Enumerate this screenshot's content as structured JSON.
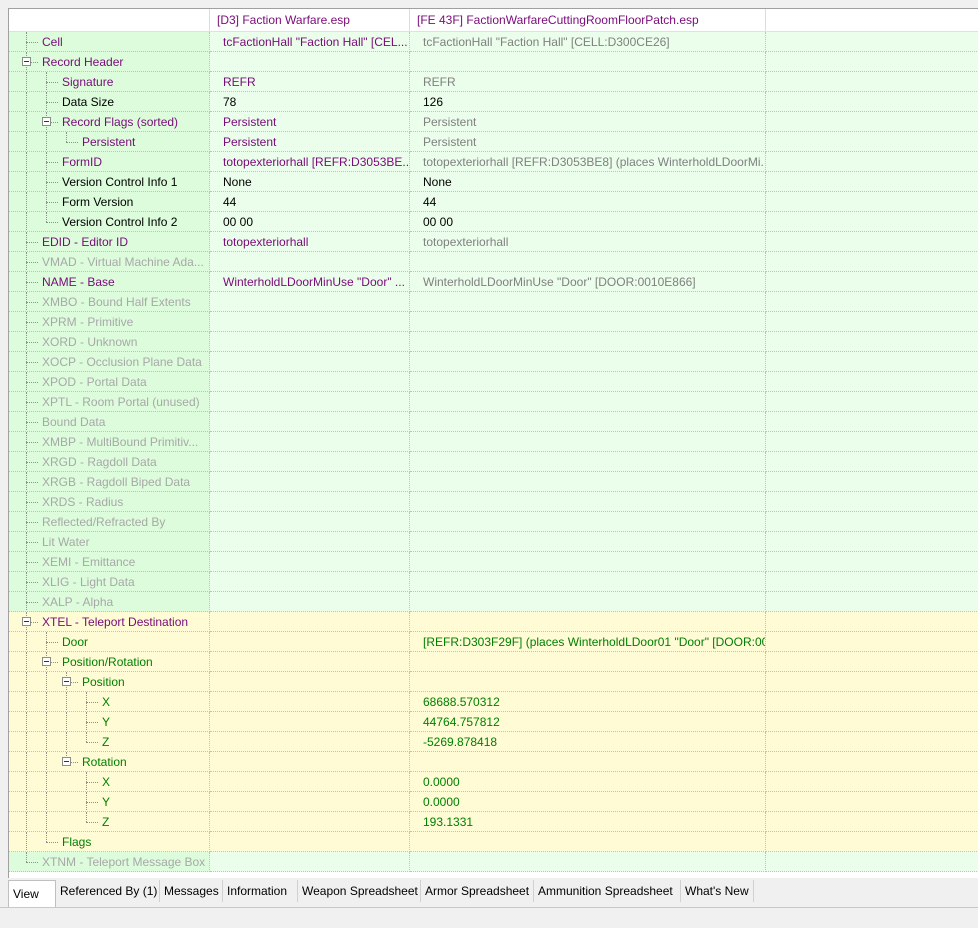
{
  "colors": {
    "win_green": "#dcfcdc",
    "lose_green": "#ebfdeb",
    "add_yellow": "#fffbd5",
    "purple_text": "#7a0b7a",
    "green_text": "#008000",
    "gray_text": "#808080",
    "dim_text": "#a8a8a8"
  },
  "columns": {
    "plugin1": "[D3] Faction Warfare.esp",
    "plugin2": "[FE 43F] FactionWarfareCuttingRoomFloorPatch.esp"
  },
  "rows": [
    {
      "label": "Cell",
      "level": 0,
      "toggle": false,
      "v1": "tcFactionHall \"Faction Hall\" [CEL...",
      "v2": "tcFactionHall \"Faction Hall\" [CELL:D300CE26]",
      "style": "conflict"
    },
    {
      "label": "Record Header",
      "level": 0,
      "toggle": true,
      "v1": "",
      "v2": "",
      "style": "conflict"
    },
    {
      "label": "Signature",
      "level": 1,
      "toggle": false,
      "v1": "REFR",
      "v2": "REFR",
      "style": "conflict"
    },
    {
      "label": "Data Size",
      "level": 1,
      "toggle": false,
      "v1": "78",
      "v2": "126",
      "style": "neutral"
    },
    {
      "label": "Record Flags (sorted)",
      "level": 1,
      "toggle": true,
      "v1": "Persistent",
      "v2": "Persistent",
      "style": "conflict"
    },
    {
      "label": "Persistent",
      "level": 2,
      "toggle": false,
      "v1": "Persistent",
      "v2": "Persistent",
      "style": "conflict"
    },
    {
      "label": "FormID",
      "level": 1,
      "toggle": false,
      "v1": "totopexteriorhall [REFR:D3053BE...",
      "v2": "totopexteriorhall [REFR:D3053BE8] (places WinterholdLDoorMi...",
      "style": "conflict"
    },
    {
      "label": "Version Control Info 1",
      "level": 1,
      "toggle": false,
      "v1": "None",
      "v2": "None",
      "style": "neutral"
    },
    {
      "label": "Form Version",
      "level": 1,
      "toggle": false,
      "v1": "44",
      "v2": "44",
      "style": "neutral"
    },
    {
      "label": "Version Control Info 2",
      "level": 1,
      "toggle": false,
      "v1": "00 00",
      "v2": "00 00",
      "style": "neutral"
    },
    {
      "label": "EDID - Editor ID",
      "level": 0,
      "toggle": false,
      "v1": "totopexteriorhall",
      "v2": "totopexteriorhall",
      "style": "conflict"
    },
    {
      "label": "VMAD - Virtual Machine Ada...",
      "level": 0,
      "toggle": false,
      "v1": "",
      "v2": "",
      "style": "empty"
    },
    {
      "label": "NAME - Base",
      "level": 0,
      "toggle": false,
      "v1": "WinterholdLDoorMinUse \"Door\" ...",
      "v2": "WinterholdLDoorMinUse \"Door\" [DOOR:0010E866]",
      "style": "conflict"
    },
    {
      "label": "XMBO - Bound Half Extents",
      "level": 0,
      "toggle": false,
      "v1": "",
      "v2": "",
      "style": "empty"
    },
    {
      "label": "XPRM - Primitive",
      "level": 0,
      "toggle": false,
      "v1": "",
      "v2": "",
      "style": "empty"
    },
    {
      "label": "XORD - Unknown",
      "level": 0,
      "toggle": false,
      "v1": "",
      "v2": "",
      "style": "empty"
    },
    {
      "label": "XOCP - Occlusion Plane Data",
      "level": 0,
      "toggle": false,
      "v1": "",
      "v2": "",
      "style": "empty"
    },
    {
      "label": "XPOD - Portal Data",
      "level": 0,
      "toggle": false,
      "v1": "",
      "v2": "",
      "style": "empty"
    },
    {
      "label": "XPTL - Room Portal (unused)",
      "level": 0,
      "toggle": false,
      "v1": "",
      "v2": "",
      "style": "empty"
    },
    {
      "label": "Bound Data",
      "level": 0,
      "toggle": false,
      "v1": "",
      "v2": "",
      "style": "empty"
    },
    {
      "label": "XMBP - MultiBound Primitiv...",
      "level": 0,
      "toggle": false,
      "v1": "",
      "v2": "",
      "style": "empty"
    },
    {
      "label": "XRGD - Ragdoll Data",
      "level": 0,
      "toggle": false,
      "v1": "",
      "v2": "",
      "style": "empty"
    },
    {
      "label": "XRGB - Ragdoll Biped Data",
      "level": 0,
      "toggle": false,
      "v1": "",
      "v2": "",
      "style": "empty"
    },
    {
      "label": "XRDS - Radius",
      "level": 0,
      "toggle": false,
      "v1": "",
      "v2": "",
      "style": "empty"
    },
    {
      "label": "Reflected/Refracted By",
      "level": 0,
      "toggle": false,
      "v1": "",
      "v2": "",
      "style": "empty"
    },
    {
      "label": "Lit Water",
      "level": 0,
      "toggle": false,
      "v1": "",
      "v2": "",
      "style": "empty"
    },
    {
      "label": "XEMI - Emittance",
      "level": 0,
      "toggle": false,
      "v1": "",
      "v2": "",
      "style": "empty"
    },
    {
      "label": "XLIG - Light Data",
      "level": 0,
      "toggle": false,
      "v1": "",
      "v2": "",
      "style": "empty"
    },
    {
      "label": "XALP - Alpha",
      "level": 0,
      "toggle": false,
      "v1": "",
      "v2": "",
      "style": "empty"
    },
    {
      "label": "XTEL - Teleport Destination",
      "level": 0,
      "toggle": true,
      "v1": "",
      "v2": "",
      "style": "added"
    },
    {
      "label": "Door",
      "level": 1,
      "toggle": false,
      "v1": "",
      "v2": "[REFR:D303F29F] (places WinterholdLDoor01 \"Door\" [DOOR:00...",
      "style": "added"
    },
    {
      "label": "Position/Rotation",
      "level": 1,
      "toggle": true,
      "v1": "",
      "v2": "",
      "style": "added"
    },
    {
      "label": "Position",
      "level": 2,
      "toggle": true,
      "v1": "",
      "v2": "",
      "style": "added"
    },
    {
      "label": "X",
      "level": 3,
      "toggle": false,
      "v1": "",
      "v2": "68688.570312",
      "style": "added"
    },
    {
      "label": "Y",
      "level": 3,
      "toggle": false,
      "v1": "",
      "v2": "44764.757812",
      "style": "added"
    },
    {
      "label": "Z",
      "level": 3,
      "toggle": false,
      "v1": "",
      "v2": "-5269.878418",
      "style": "added"
    },
    {
      "label": "Rotation",
      "level": 2,
      "toggle": true,
      "v1": "",
      "v2": "",
      "style": "added"
    },
    {
      "label": "X",
      "level": 3,
      "toggle": false,
      "v1": "",
      "v2": "0.0000",
      "style": "added"
    },
    {
      "label": "Y",
      "level": 3,
      "toggle": false,
      "v1": "",
      "v2": "0.0000",
      "style": "added"
    },
    {
      "label": "Z",
      "level": 3,
      "toggle": false,
      "v1": "",
      "v2": "193.1331",
      "style": "added"
    },
    {
      "label": "Flags",
      "level": 1,
      "toggle": false,
      "v1": "",
      "v2": "",
      "style": "added"
    },
    {
      "label": "XTNM - Teleport Message Box",
      "level": 0,
      "toggle": false,
      "v1": "",
      "v2": "",
      "style": "empty"
    }
  ],
  "tabs": [
    {
      "label": "View",
      "active": true
    },
    {
      "label": "Referenced By (1)",
      "active": false
    },
    {
      "label": "Messages",
      "active": false
    },
    {
      "label": "Information",
      "active": false
    },
    {
      "label": "Weapon Spreadsheet",
      "active": false
    },
    {
      "label": "Armor Spreadsheet",
      "active": false
    },
    {
      "label": "Ammunition Spreadsheet",
      "active": false
    },
    {
      "label": "What's New",
      "active": false
    }
  ]
}
